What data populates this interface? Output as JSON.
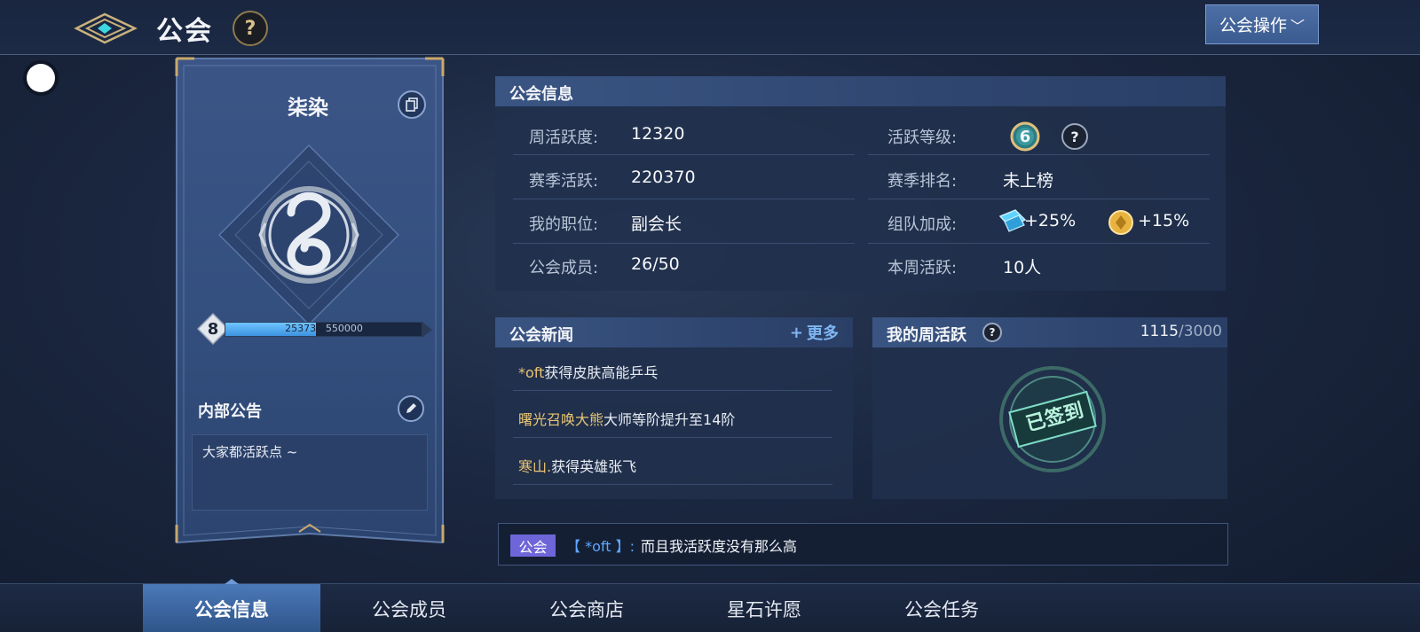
{
  "header": {
    "title": "公会",
    "help_label": "?",
    "guild_ops_label": "公会操作"
  },
  "banner": {
    "guild_name": "柒染",
    "level": "8",
    "xp_current": "253734",
    "xp_separator": "/",
    "xp_max": "550000",
    "xp_progress": 0.4613,
    "notice_label": "内部公告",
    "notice_text": "大家都活跃点 ~"
  },
  "info": {
    "title": "公会信息",
    "rows": [
      {
        "label": "周活跃度:",
        "value": "12320"
      },
      {
        "label": "赛季活跃:",
        "value": "220370"
      },
      {
        "label": "我的职位:",
        "value": "副会长"
      },
      {
        "label": "公会成员:",
        "value": "26/50"
      }
    ],
    "right_rows": [
      {
        "label": "活跃等级:"
      },
      {
        "label": "赛季排名:",
        "value": "未上榜"
      },
      {
        "label": "组队加成:"
      },
      {
        "label": "本周活跃:",
        "value": "10人"
      }
    ],
    "activity_level": "6",
    "help_label": "?",
    "buff1": "+25%",
    "buff2": "+15%"
  },
  "news": {
    "title": "公会新闻",
    "more_label": "更多",
    "items": [
      {
        "name": "*oft",
        "text": "获得皮肤高能乒乓"
      },
      {
        "name": "曙光召唤大熊",
        "text": "大师等阶提升至14阶"
      },
      {
        "name": "寒山.",
        "text": "获得英雄张飞"
      }
    ]
  },
  "weekly": {
    "title": "我的周活跃",
    "help_label": "?",
    "current": "1115",
    "total": "/3000",
    "stamp_label": "已签到"
  },
  "chat": {
    "tag": "公会",
    "speaker": "【 *oft 】:",
    "message": "而且我活跃度没有那么高"
  },
  "tabs": [
    {
      "label": "公会信息",
      "active": true
    },
    {
      "label": "公会成员",
      "active": false
    },
    {
      "label": "公会商店",
      "active": false
    },
    {
      "label": "星石许愿",
      "active": false
    },
    {
      "label": "公会任务",
      "active": false
    }
  ],
  "colors": {
    "accent_gold": "#e9c574",
    "accent_blue": "#5fa7ff",
    "chat_tag": "#6e66d8",
    "xp_fill": "#4aa3ec",
    "tab_active": "#3f6aa8"
  }
}
